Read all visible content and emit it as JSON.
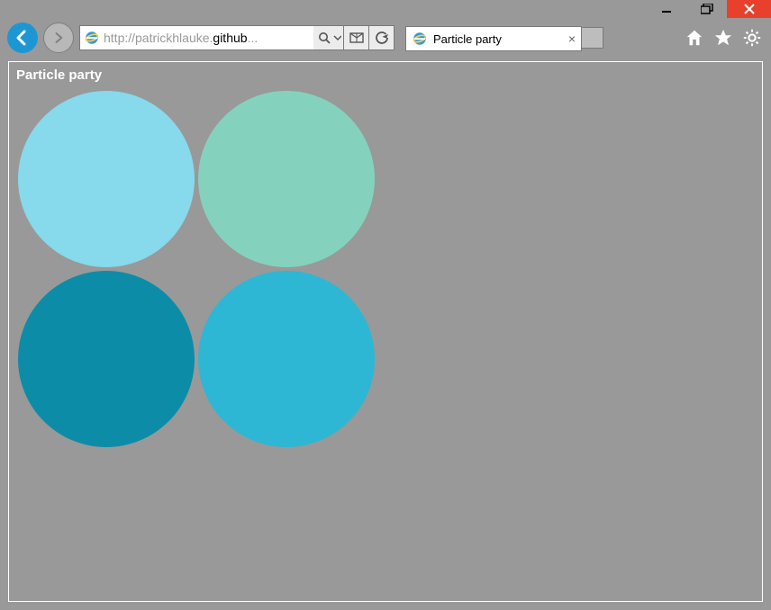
{
  "browser": {
    "address": {
      "prefix": "http://patrickhlauke.",
      "highlight": "github",
      "suffix": "..."
    },
    "tab": {
      "title": "Particle party"
    }
  },
  "page": {
    "heading": "Particle party",
    "circles": {
      "c1": "#87d9ec",
      "c2": "#84d2bd",
      "c3": "#0d8ca8",
      "c4": "#2db7d4"
    }
  }
}
